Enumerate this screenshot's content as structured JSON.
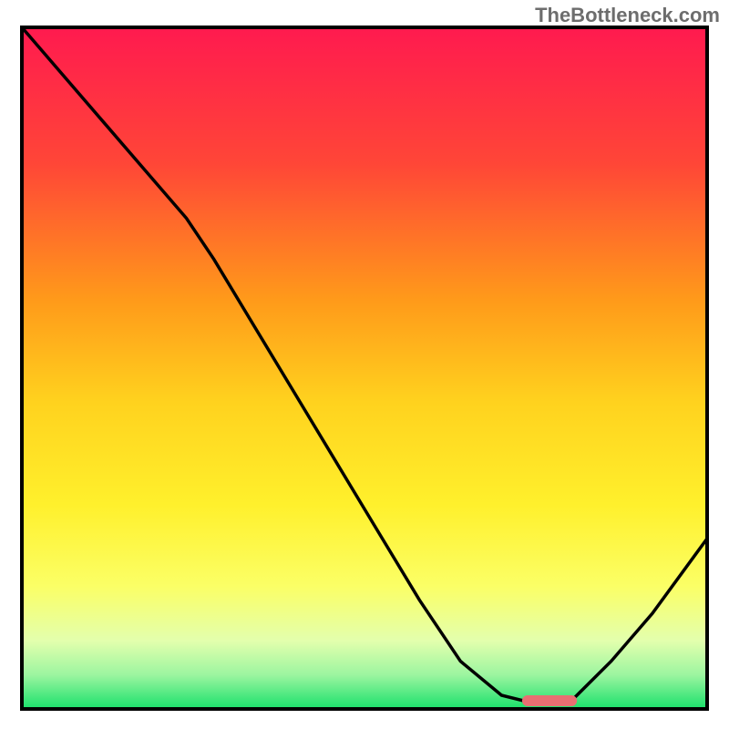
{
  "watermark": "TheBottleneck.com",
  "chart_data": {
    "type": "line",
    "title": "",
    "xlabel": "",
    "ylabel": "",
    "xlim": [
      0,
      100
    ],
    "ylim": [
      0,
      100
    ],
    "description": "Bottleneck curve over a red-yellow-green vertical gradient background. Curve descends from top-left to a minimum near x≈77 then rises toward the right edge. A short red rounded marker sits at the valley.",
    "series": [
      {
        "name": "bottleneck-curve",
        "x": [
          0,
          6,
          12,
          18,
          24,
          28,
          34,
          40,
          46,
          52,
          58,
          64,
          70,
          74,
          80,
          86,
          92,
          100
        ],
        "y": [
          100,
          93,
          86,
          79,
          72,
          66,
          56,
          46,
          36,
          26,
          16,
          7,
          2,
          1,
          1,
          7,
          14,
          25
        ]
      }
    ],
    "valley_marker": {
      "x_start": 73,
      "x_end": 81,
      "y": 1.2
    },
    "gradient_stops": [
      {
        "offset": 0,
        "color": "#ff1a4f"
      },
      {
        "offset": 20,
        "color": "#ff4637"
      },
      {
        "offset": 40,
        "color": "#ff9a1a"
      },
      {
        "offset": 55,
        "color": "#ffd21e"
      },
      {
        "offset": 70,
        "color": "#fff02c"
      },
      {
        "offset": 82,
        "color": "#fbff66"
      },
      {
        "offset": 90,
        "color": "#e3ffad"
      },
      {
        "offset": 95,
        "color": "#9cf5a0"
      },
      {
        "offset": 100,
        "color": "#19e06b"
      }
    ],
    "frame_color": "#000000",
    "curve_color": "#000000",
    "marker_color": "#e86f72"
  }
}
